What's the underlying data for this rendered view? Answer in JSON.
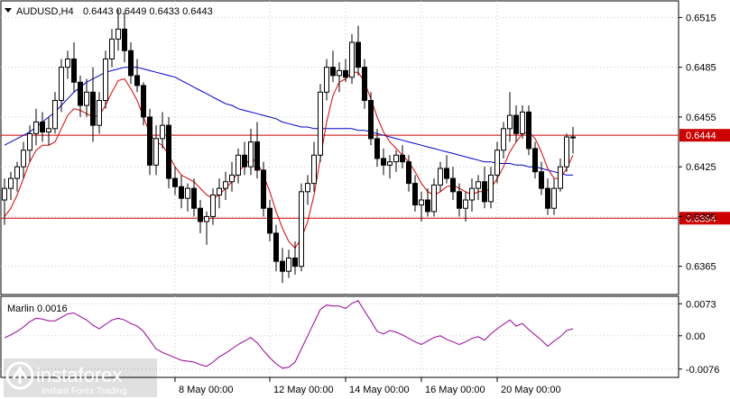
{
  "header": {
    "symbol": "AUDUSD,H4",
    "ohlc": "0.6443 0.6449 0.6433 0.6443"
  },
  "indicator": {
    "label": "Marlin 0.0016"
  },
  "watermark": {
    "brand": "instaforex",
    "tagline": "Instant Forex Trading"
  },
  "colors": {
    "background": "#ffffff",
    "candle": "#000000",
    "ma_slow": "#0000cc",
    "ma_fast": "#dd0000",
    "level": "#cc0000",
    "oscillator": "#990099",
    "grid": "#c8c8c8"
  },
  "chart_data": [
    {
      "type": "candlestick",
      "title": "AUDUSD,H4",
      "x_tick_labels": [
        "8 May 00:00",
        "12 May 00:00",
        "14 May 00:00",
        "16 May 00:00",
        "20 May 00:00"
      ],
      "y_ticks": [
        0.6365,
        0.6395,
        0.6425,
        0.6455,
        0.6485,
        0.6515
      ],
      "y_tick_labels": [
        "0.6365",
        "0.6395",
        "0.6425",
        "0.6455",
        "0.6485",
        "0.6515"
      ],
      "ylim": [
        0.6348,
        0.6525
      ],
      "grid": true,
      "horizontal_levels": [
        {
          "value": 0.6444,
          "label": "0.6444"
        },
        {
          "value": 0.6394,
          "label": "0.6394"
        }
      ],
      "candles": [
        [
          0.6405,
          0.6418,
          0.639,
          0.6412
        ],
        [
          0.6412,
          0.6422,
          0.6405,
          0.6418
        ],
        [
          0.6418,
          0.6428,
          0.641,
          0.6425
        ],
        [
          0.6425,
          0.644,
          0.6418,
          0.6435
        ],
        [
          0.6435,
          0.645,
          0.6428,
          0.6445
        ],
        [
          0.6445,
          0.646,
          0.6438,
          0.6452
        ],
        [
          0.6452,
          0.6458,
          0.644,
          0.6446
        ],
        [
          0.6446,
          0.6455,
          0.6438,
          0.6448
        ],
        [
          0.6448,
          0.647,
          0.6445,
          0.6465
        ],
        [
          0.6465,
          0.649,
          0.6458,
          0.6485
        ],
        [
          0.6485,
          0.6495,
          0.6478,
          0.649
        ],
        [
          0.649,
          0.65,
          0.647,
          0.6476
        ],
        [
          0.6476,
          0.648,
          0.6455,
          0.6462
        ],
        [
          0.6462,
          0.6478,
          0.6455,
          0.647
        ],
        [
          0.647,
          0.6485,
          0.644,
          0.645
        ],
        [
          0.645,
          0.647,
          0.6445,
          0.6465
        ],
        [
          0.6465,
          0.6495,
          0.646,
          0.649
        ],
        [
          0.649,
          0.6508,
          0.6485,
          0.6502
        ],
        [
          0.6502,
          0.652,
          0.6495,
          0.6508
        ],
        [
          0.6508,
          0.6518,
          0.6488,
          0.6495
        ],
        [
          0.6495,
          0.65,
          0.6475,
          0.648
        ],
        [
          0.648,
          0.649,
          0.647,
          0.6474
        ],
        [
          0.6474,
          0.6476,
          0.645,
          0.6455
        ],
        [
          0.6455,
          0.646,
          0.642,
          0.6426
        ],
        [
          0.6426,
          0.645,
          0.642,
          0.6442
        ],
        [
          0.6442,
          0.6458,
          0.6436,
          0.645
        ],
        [
          0.645,
          0.6455,
          0.6412,
          0.6418
        ],
        [
          0.6418,
          0.6425,
          0.6408,
          0.6413
        ],
        [
          0.6413,
          0.642,
          0.64,
          0.6406
        ],
        [
          0.6406,
          0.6415,
          0.6398,
          0.6412
        ],
        [
          0.6412,
          0.6418,
          0.6395,
          0.64
        ],
        [
          0.64,
          0.6405,
          0.6385,
          0.6392
        ],
        [
          0.6392,
          0.6398,
          0.6378,
          0.6395
        ],
        [
          0.6395,
          0.6412,
          0.639,
          0.6408
        ],
        [
          0.6408,
          0.6418,
          0.64,
          0.6412
        ],
        [
          0.6412,
          0.6422,
          0.6405,
          0.6416
        ],
        [
          0.6416,
          0.6428,
          0.641,
          0.642
        ],
        [
          0.642,
          0.6436,
          0.6415,
          0.6432
        ],
        [
          0.6432,
          0.644,
          0.642,
          0.6425
        ],
        [
          0.6425,
          0.6448,
          0.642,
          0.644
        ],
        [
          0.644,
          0.6452,
          0.6418,
          0.6423
        ],
        [
          0.6423,
          0.6428,
          0.6395,
          0.64
        ],
        [
          0.64,
          0.6405,
          0.638,
          0.6385
        ],
        [
          0.6385,
          0.639,
          0.6362,
          0.6368
        ],
        [
          0.6368,
          0.6376,
          0.6355,
          0.6362
        ],
        [
          0.6362,
          0.6375,
          0.6358,
          0.637
        ],
        [
          0.637,
          0.638,
          0.636,
          0.6365
        ],
        [
          0.6365,
          0.6415,
          0.6362,
          0.641
        ],
        [
          0.641,
          0.642,
          0.6402,
          0.6415
        ],
        [
          0.6415,
          0.644,
          0.641,
          0.6432
        ],
        [
          0.6432,
          0.6475,
          0.6428,
          0.647
        ],
        [
          0.647,
          0.649,
          0.6465,
          0.6485
        ],
        [
          0.6485,
          0.6495,
          0.6476,
          0.648
        ],
        [
          0.648,
          0.6488,
          0.647,
          0.6483
        ],
        [
          0.6483,
          0.649,
          0.6476,
          0.6479
        ],
        [
          0.6479,
          0.6505,
          0.6475,
          0.65
        ],
        [
          0.65,
          0.651,
          0.648,
          0.6485
        ],
        [
          0.6485,
          0.649,
          0.646,
          0.6465
        ],
        [
          0.6465,
          0.647,
          0.6438,
          0.6442
        ],
        [
          0.6442,
          0.6448,
          0.6425,
          0.643
        ],
        [
          0.643,
          0.6436,
          0.642,
          0.6426
        ],
        [
          0.6426,
          0.6432,
          0.6418,
          0.6428
        ],
        [
          0.6428,
          0.6435,
          0.6422,
          0.6432
        ],
        [
          0.6432,
          0.6438,
          0.6424,
          0.6428
        ],
        [
          0.6428,
          0.6432,
          0.641,
          0.6415
        ],
        [
          0.6415,
          0.642,
          0.6398,
          0.6402
        ],
        [
          0.6402,
          0.641,
          0.6392,
          0.6405
        ],
        [
          0.6405,
          0.6412,
          0.6395,
          0.6398
        ],
        [
          0.6398,
          0.6418,
          0.6395,
          0.6414
        ],
        [
          0.6414,
          0.6428,
          0.641,
          0.6424
        ],
        [
          0.6424,
          0.6432,
          0.6415,
          0.6418
        ],
        [
          0.6418,
          0.6425,
          0.6405,
          0.641
        ],
        [
          0.641,
          0.6415,
          0.6395,
          0.64
        ],
        [
          0.64,
          0.641,
          0.6392,
          0.6405
        ],
        [
          0.6405,
          0.6418,
          0.6398,
          0.6412
        ],
        [
          0.6412,
          0.642,
          0.6405,
          0.6416
        ],
        [
          0.6416,
          0.6425,
          0.64,
          0.6404
        ],
        [
          0.6404,
          0.6425,
          0.64,
          0.642
        ],
        [
          0.642,
          0.644,
          0.6415,
          0.6435
        ],
        [
          0.6435,
          0.6452,
          0.643,
          0.6448
        ],
        [
          0.6448,
          0.647,
          0.644,
          0.6456
        ],
        [
          0.6456,
          0.6462,
          0.644,
          0.6445
        ],
        [
          0.6445,
          0.6462,
          0.6442,
          0.6458
        ],
        [
          0.6458,
          0.6462,
          0.6432,
          0.6436
        ],
        [
          0.6436,
          0.644,
          0.6418,
          0.6422
        ],
        [
          0.6422,
          0.6428,
          0.6408,
          0.6412
        ],
        [
          0.6412,
          0.6418,
          0.6396,
          0.64
        ],
        [
          0.64,
          0.6418,
          0.6396,
          0.6412
        ],
        [
          0.6412,
          0.643,
          0.641,
          0.6425
        ],
        [
          0.6425,
          0.6445,
          0.6422,
          0.6443
        ],
        [
          0.6443,
          0.6449,
          0.6433,
          0.6443
        ]
      ],
      "ma_slow": [
        0.6438,
        0.644,
        0.6442,
        0.6444,
        0.6446,
        0.6449,
        0.6452,
        0.6455,
        0.6458,
        0.6462,
        0.6466,
        0.647,
        0.6473,
        0.6476,
        0.6478,
        0.648,
        0.6482,
        0.6483,
        0.6484,
        0.6485,
        0.6485,
        0.6485,
        0.6484,
        0.6483,
        0.6482,
        0.6481,
        0.648,
        0.6479,
        0.6477,
        0.6475,
        0.6473,
        0.6471,
        0.6469,
        0.6467,
        0.6465,
        0.6463,
        0.6462,
        0.646,
        0.6459,
        0.6458,
        0.6457,
        0.6456,
        0.6455,
        0.6454,
        0.6452,
        0.6451,
        0.645,
        0.6449,
        0.6449,
        0.6448,
        0.6448,
        0.6448,
        0.6448,
        0.6448,
        0.6448,
        0.6448,
        0.6447,
        0.6447,
        0.6446,
        0.6445,
        0.6444,
        0.6443,
        0.6442,
        0.6441,
        0.644,
        0.6439,
        0.6438,
        0.6437,
        0.6436,
        0.6435,
        0.6434,
        0.6433,
        0.6432,
        0.6431,
        0.643,
        0.6429,
        0.6428,
        0.6428,
        0.6427,
        0.6427,
        0.6427,
        0.6426,
        0.6426,
        0.6425,
        0.6425,
        0.6424,
        0.6423,
        0.6422,
        0.6421,
        0.642,
        0.642
      ],
      "ma_fast": [
        0.6395,
        0.64,
        0.6408,
        0.6418,
        0.6428,
        0.6435,
        0.6438,
        0.6438,
        0.644,
        0.6448,
        0.6456,
        0.646,
        0.6459,
        0.6457,
        0.6455,
        0.6456,
        0.6462,
        0.647,
        0.6477,
        0.6478,
        0.6472,
        0.6465,
        0.6455,
        0.6445,
        0.644,
        0.6438,
        0.6432,
        0.6425,
        0.642,
        0.6418,
        0.6416,
        0.6412,
        0.6408,
        0.6406,
        0.6408,
        0.6412,
        0.6416,
        0.6422,
        0.6426,
        0.643,
        0.6428,
        0.642,
        0.641,
        0.6398,
        0.6388,
        0.638,
        0.6376,
        0.6382,
        0.6392,
        0.6408,
        0.643,
        0.6452,
        0.6468,
        0.6476,
        0.6478,
        0.6482,
        0.6482,
        0.6476,
        0.6466,
        0.6455,
        0.6446,
        0.644,
        0.6436,
        0.6432,
        0.6428,
        0.6422,
        0.6415,
        0.641,
        0.6408,
        0.641,
        0.6413,
        0.6414,
        0.6412,
        0.641,
        0.6408,
        0.641,
        0.641,
        0.6412,
        0.6418,
        0.6425,
        0.6434,
        0.644,
        0.6445,
        0.6446,
        0.6442,
        0.6434,
        0.6424,
        0.6418,
        0.6418,
        0.6424,
        0.6432
      ]
    },
    {
      "type": "line",
      "title": "Marlin 0.0016",
      "y_ticks": [
        0.0073,
        0.0,
        -0.0076
      ],
      "y_tick_labels": [
        "0.0073",
        "0.00",
        "-0.0076"
      ],
      "ylim": [
        -0.0095,
        0.009
      ],
      "series": [
        {
          "name": "Marlin",
          "values": [
            -0.0005,
            0.0002,
            0.001,
            0.002,
            0.0032,
            0.004,
            0.0038,
            0.0034,
            0.0034,
            0.0042,
            0.005,
            0.0052,
            0.0044,
            0.0036,
            0.0024,
            0.0016,
            0.0026,
            0.0036,
            0.004,
            0.0036,
            0.0028,
            0.0022,
            0.001,
            -0.001,
            -0.003,
            -0.0038,
            -0.0044,
            -0.005,
            -0.0056,
            -0.0058,
            -0.006,
            -0.0066,
            -0.007,
            -0.006,
            -0.0048,
            -0.004,
            -0.003,
            -0.002,
            -0.0012,
            -0.0004,
            -0.0016,
            -0.0034,
            -0.005,
            -0.0064,
            -0.0074,
            -0.0072,
            -0.006,
            -0.003,
            0.0,
            0.003,
            0.006,
            0.007,
            0.0068,
            0.0068,
            0.0062,
            0.0074,
            0.008,
            0.0056,
            0.0034,
            0.001,
            0.0004,
            0.0012,
            0.0008,
            0.0002,
            -0.0006,
            -0.0014,
            -0.002,
            -0.0012,
            -0.0004,
            0.0,
            -0.0008,
            -0.0014,
            -0.002,
            -0.0014,
            -0.0006,
            -0.0002,
            -0.001,
            0.0004,
            0.0016,
            0.0026,
            0.0036,
            0.0022,
            0.0028,
            0.0014,
            0.0002,
            -0.001,
            -0.0024,
            -0.0012,
            -0.0002,
            0.0012,
            0.0016
          ]
        }
      ]
    }
  ]
}
